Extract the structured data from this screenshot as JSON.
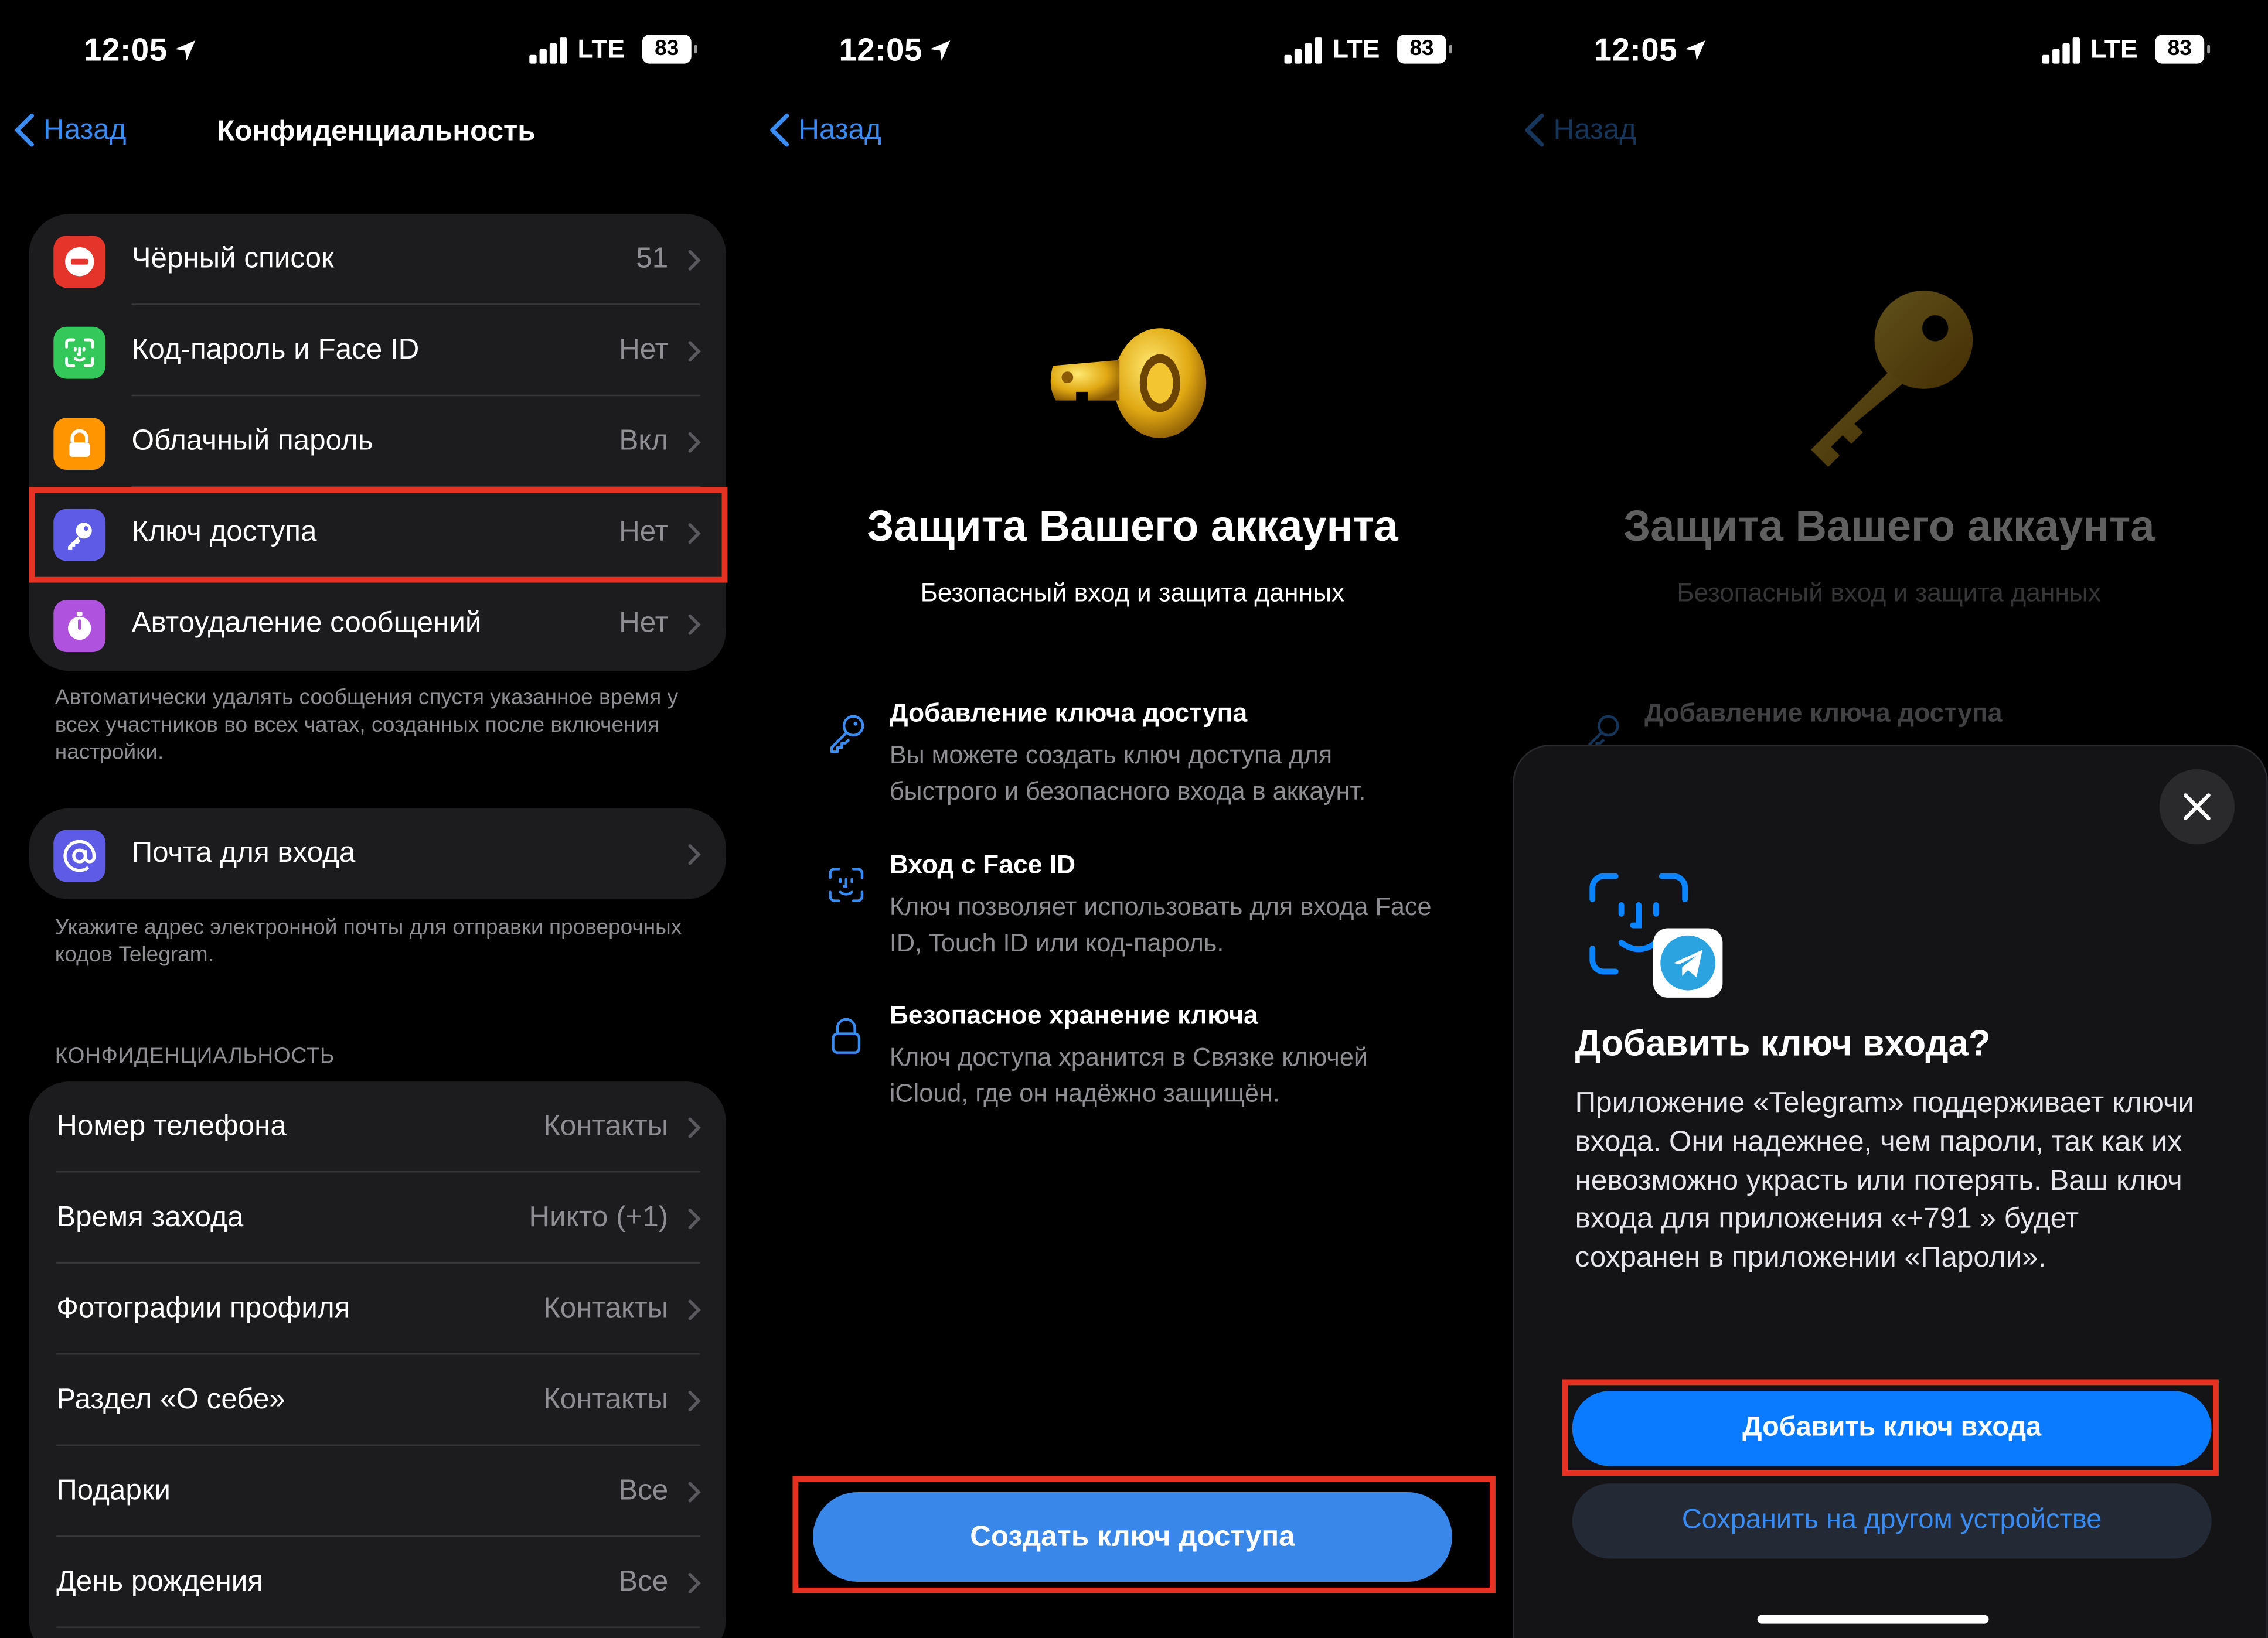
{
  "status": {
    "time": "12:05",
    "network": "LTE",
    "battery": "83"
  },
  "screen1": {
    "back": "Назад",
    "title": "Конфиденциальность",
    "security_items": [
      {
        "label": "Чёрный список",
        "value": "51",
        "icon": "block-icon",
        "color": "#e5342a"
      },
      {
        "label": "Код-пароль и Face ID",
        "value": "Нет",
        "icon": "face-id-icon",
        "color": "#34c759"
      },
      {
        "label": "Облачный пароль",
        "value": "Вкл",
        "icon": "lock-icon",
        "color": "#ff9500"
      },
      {
        "label": "Ключ доступа",
        "value": "Нет",
        "icon": "key-icon",
        "color": "#5e5ce6"
      },
      {
        "label": "Автоудаление сообщений",
        "value": "Нет",
        "icon": "timer-icon",
        "color": "#af52de"
      }
    ],
    "autodelete_note": "Автоматически удалять сообщения спустя указанное время у всех участников во всех чатах, созданных после включения настройки.",
    "login_email": {
      "label": "Почта для входа",
      "icon": "at-icon",
      "color": "#5e5ce6"
    },
    "email_note": "Укажите адрес электронной почты для отправки проверочных кодов Telegram.",
    "privacy_header": "КОНФИДЕНЦИАЛЬНОСТЬ",
    "privacy_items": [
      {
        "label": "Номер телефона",
        "value": "Контакты"
      },
      {
        "label": "Время захода",
        "value": "Никто (+1)"
      },
      {
        "label": "Фотографии профиля",
        "value": "Контакты"
      },
      {
        "label": "Раздел «О себе»",
        "value": "Контакты"
      },
      {
        "label": "Подарки",
        "value": "Все"
      },
      {
        "label": "День рождения",
        "value": "Все"
      }
    ]
  },
  "screen2": {
    "back": "Назад",
    "title": "Защита Вашего аккаунта",
    "subtitle": "Безопасный вход и защита данных",
    "features": [
      {
        "title": "Добавление ключа доступа",
        "desc": "Вы можете создать ключ доступа для быстрого и безопасного входа в аккаунт.",
        "icon": "key-outline-icon"
      },
      {
        "title": "Вход с Face ID",
        "desc": "Ключ позволяет использовать для входа Face ID, Touch ID или код-пароль.",
        "icon": "face-id-outline-icon"
      },
      {
        "title": "Безопасное хранение ключа",
        "desc": "Ключ доступа хранится в Связке ключей iCloud, где он надёжно защищён.",
        "icon": "lock-outline-icon"
      }
    ],
    "create_button": "Создать ключ доступа"
  },
  "screen3": {
    "back": "Назад",
    "title": "Защита Вашего аккаунта",
    "subtitle": "Безопасный вход и защита данных",
    "feature_title": "Добавление ключа доступа",
    "sheet": {
      "title": "Добавить ключ входа?",
      "body": "Приложение «Telegram» поддерживает ключи входа. Они надежнее, чем пароли, так как их невозможно украсть или поте­рять. Ваш ключ входа для приложения «+791            » будет сохранен в прило­жении «Пароли».",
      "add_button": "Добавить ключ входа",
      "other_button": "Сохранить на другом устройстве"
    }
  },
  "colors": {
    "accent": "#3b8cf2",
    "highlight": "#e53222",
    "cell": "#1c1c1e"
  }
}
